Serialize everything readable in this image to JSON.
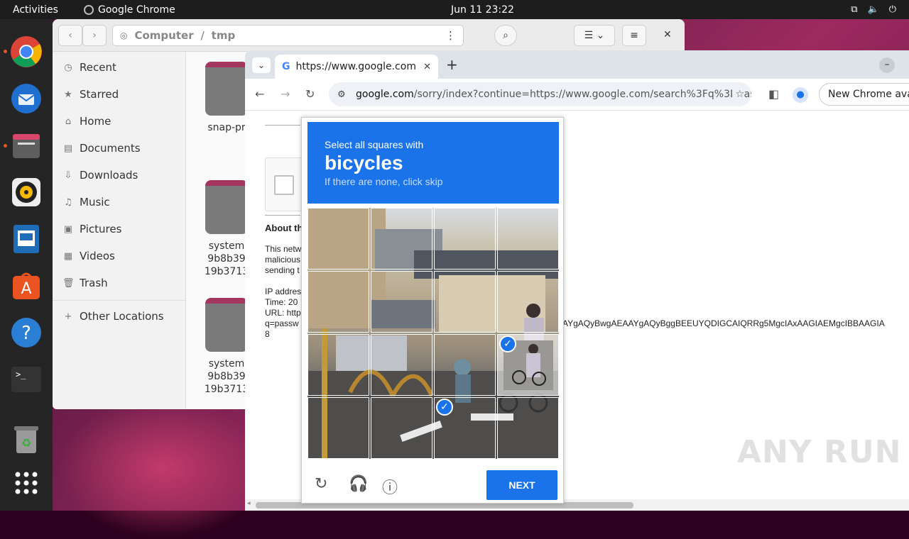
{
  "topbar": {
    "activities": "Activities",
    "app_name": "Google Chrome",
    "clock": "Jun 11  23:22"
  },
  "files": {
    "path_computer": "Computer",
    "path_sep": "/",
    "path_folder": "tmp",
    "sidebar": [
      {
        "label": "Recent",
        "icon": "clock-icon"
      },
      {
        "label": "Starred",
        "icon": "star-icon"
      },
      {
        "label": "Home",
        "icon": "home-icon"
      },
      {
        "label": "Documents",
        "icon": "document-icon"
      },
      {
        "label": "Downloads",
        "icon": "download-icon"
      },
      {
        "label": "Music",
        "icon": "music-icon"
      },
      {
        "label": "Pictures",
        "icon": "picture-icon"
      },
      {
        "label": "Videos",
        "icon": "video-icon"
      },
      {
        "label": "Trash",
        "icon": "trash-icon"
      }
    ],
    "other_locations": "Other Locations",
    "items": [
      {
        "line1": "snap-pr",
        "line2": "",
        "line3": ""
      },
      {
        "line1": "system",
        "line2": "9b8b39",
        "line3": "19b3713"
      },
      {
        "line1": "system",
        "line2": "9b8b39",
        "line3": "19b3713"
      }
    ]
  },
  "chrome": {
    "tab_title": "https://www.google.com",
    "url_host": "google.com",
    "url_rest": "/sorry/index?continue=https://www.google.com/search%3Fq%3Dpas...",
    "new_chrome": "New Chrome ava"
  },
  "page": {
    "about_heading": "About th",
    "lines1": [
      "This netw",
      "malicious",
      "sending t"
    ],
    "lines2": [
      "IP addres",
      "Time: 20",
      "URL: http",
      "q=passw",
      "8"
    ],
    "url_tail": "AYgAQyBwgAEAAYgAQyBggBEEUYQDIGCAIQRRg5MgcIAxAAGIAEMgcIBBAAGIA"
  },
  "captcha": {
    "line1": "Select all squares with",
    "line2": "bicycles",
    "line3": "If there are none, click skip",
    "next_label": "NEXT",
    "selected": [
      [
        2,
        3
      ],
      [
        3,
        2
      ]
    ]
  },
  "watermark": "ANY RUN"
}
